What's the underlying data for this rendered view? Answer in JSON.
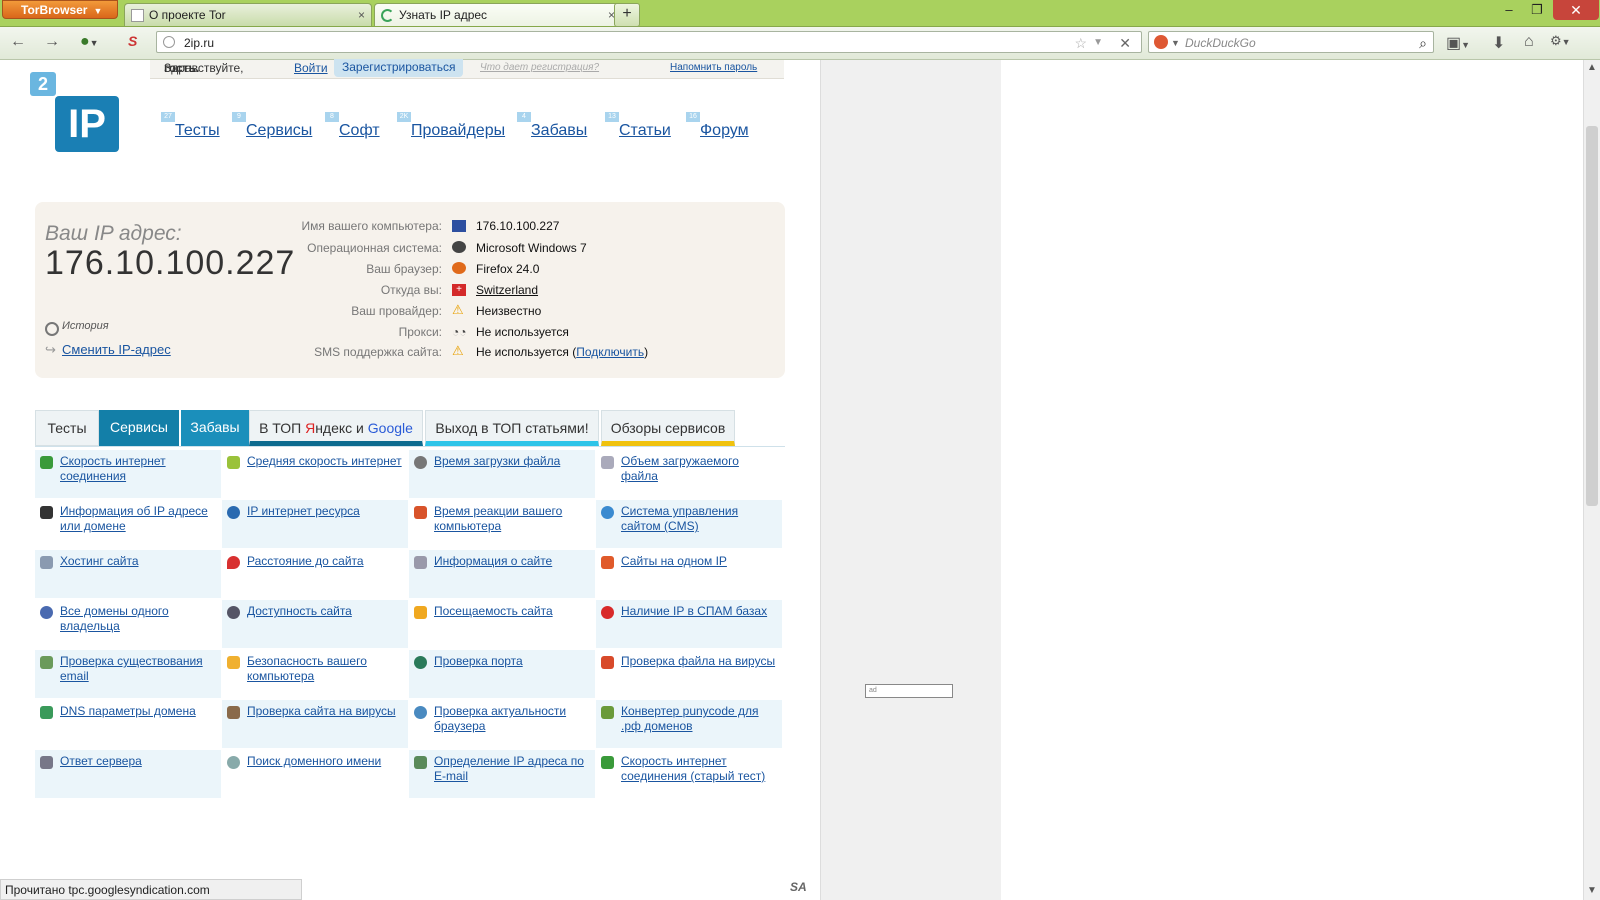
{
  "browser": {
    "menu_button": "TorBrowser",
    "tabs": [
      {
        "title": "О проекте Tor",
        "close": "×"
      },
      {
        "title": "Узнать IP адрес",
        "close": "×"
      }
    ],
    "new_tab": "+",
    "url": "2ip.ru",
    "search_placeholder": "DuckDuckGo",
    "status_text": "Прочитано tpc.googlesyndication.com"
  },
  "site": {
    "greeting": "Здравствуйте,",
    "user": "гость.",
    "login": "Войти",
    "register": "Зарегистрироваться",
    "why_register": "Что дает регистрация?",
    "remind_password": "Напомнить пароль",
    "logo_small": "2",
    "logo_big": "IP",
    "menu": [
      {
        "label": "Тесты",
        "count": "27"
      },
      {
        "label": "Сервисы",
        "count": "9"
      },
      {
        "label": "Софт",
        "count": "8"
      },
      {
        "label": "Провайдеры",
        "count": "2K"
      },
      {
        "label": "Забавы",
        "count": "4"
      },
      {
        "label": "Статьи",
        "count": "13"
      },
      {
        "label": "Форум",
        "count": "16"
      }
    ],
    "ip_label": "Ваш IP адрес:",
    "ip_value": "176.10.100.227",
    "history": "История",
    "change_ip": "Сменить IP-адрес",
    "info": [
      {
        "label": "Имя вашего компьютера:",
        "value": "176.10.100.227",
        "link": false,
        "icon": "computer-icon"
      },
      {
        "label": "Операционная система:",
        "value": "Microsoft Windows 7",
        "link": false,
        "icon": "windows-icon"
      },
      {
        "label": "Ваш браузер:",
        "value": "Firefox 24.0",
        "link": false,
        "icon": "firefox-icon"
      },
      {
        "label": "Откуда вы:",
        "value": "Switzerland",
        "link": true,
        "icon": "swiss-flag-icon"
      },
      {
        "label": "Ваш провайдер:",
        "value": "Неизвестно",
        "link": false,
        "icon": "warning-icon"
      },
      {
        "label": "Прокси:",
        "value": "Не используется",
        "link": false,
        "icon": "glasses-icon"
      },
      {
        "label": "SMS поддержка сайта:",
        "value": "Не используется",
        "link": false,
        "icon": "warning-icon"
      }
    ],
    "sms_connect": "Подключить",
    "sms_open": "(",
    "sms_close": ")",
    "tabs": [
      {
        "label": "Тесты"
      },
      {
        "label": "Сервисы"
      },
      {
        "label": "Забавы"
      },
      {
        "label_pre": "В ТОП ",
        "label_yandex": "Я",
        "label_mid": "ндекс и ",
        "label_google": "Google"
      },
      {
        "label": "Выход в ТОП статьями!"
      },
      {
        "label": "Обзоры сервисов"
      }
    ],
    "services": [
      [
        "Скорость интернет соединения",
        "Средняя скорость интернет",
        "Время загрузки файла",
        "Объем загружаемого файла"
      ],
      [
        "Информация об IP адресе или домене",
        "IP интернет ресурса",
        "Время реакции вашего компьютера",
        "Система управления сайтом (CMS)"
      ],
      [
        "Хостинг сайта",
        "Расстояние до сайта",
        "Информация о сайте",
        "Сайты на одном IP"
      ],
      [
        "Все домены одного владельца",
        "Доступность сайта",
        "Посещаемость сайта",
        "Наличие IP в СПАМ базах"
      ],
      [
        "Проверка существования email",
        "Безопасность вашего компьютера",
        "Проверка порта",
        "Проверка файла на вирусы"
      ],
      [
        "DNS параметры домена",
        "Проверка сайта на вирусы",
        "Проверка актуальности браузера",
        "Конвертер punycode для .рф доменов"
      ],
      [
        "Ответ сервера",
        "Поиск доменного имени",
        "Определение IP адреса по E-mail",
        "Скорость интернет соединения (старый тест)"
      ]
    ],
    "footer_logo": "SA"
  },
  "colors": {
    "accent": "#137fa8",
    "titlebar": "#a9d15e",
    "ip_box": "#f6f2ec",
    "cell_blue": "#ebf5fa"
  }
}
